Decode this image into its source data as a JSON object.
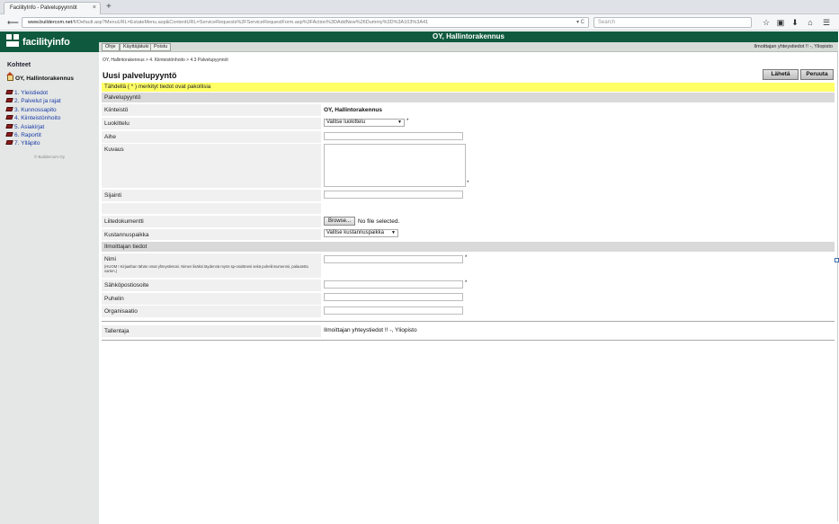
{
  "browser": {
    "tab_title": "FacilityInfo - Palvelupyynnöt",
    "tab_close": "×",
    "new_tab": "+",
    "url_host": "www.buildercom.net",
    "url_path": "/fi/Default.asp?MenuURL=EstateMenu.asp&ContentURL=ServiceRequests%2FServiceRequestForm.asp%3FAction%3DAddNew%26Dummy%3D%3A103%3A41",
    "search_placeholder": "Search",
    "back_glyph": "⟵",
    "tools": [
      "☆",
      "▣",
      "⬇",
      "⌂",
      "☰"
    ],
    "url_icons": "▾ C"
  },
  "app": {
    "logo_text": "facilityinfo",
    "header_title": "OY, Hallintorakennus",
    "menu": [
      "Ohje",
      "Käyttäjätuki",
      "Poistu"
    ],
    "user_info": "Ilmoittajan yhteystiedot !! -, Yliopisto"
  },
  "sidebar": {
    "title": "Kohteet",
    "property": "OY, Hallintorakennus",
    "items": [
      {
        "label": "1. Yleistiedot"
      },
      {
        "label": "2. Palvelut ja rajat"
      },
      {
        "label": "3. Kunnossapito"
      },
      {
        "label": "4. Kiinteistönhoito"
      },
      {
        "label": "5. Asiakirjat"
      },
      {
        "label": "6. Raportit"
      },
      {
        "label": "7. Ylläpito"
      }
    ],
    "copyright": "© Buildercom Oy"
  },
  "main": {
    "breadcrumb": "OY, Hallintorakennus > 4. Kiinteistönhoito > 4.3 Palvelupyynnöt",
    "page_title": "Uusi palvelupyyntö",
    "send_button": "Lähetä",
    "cancel_button": "Peruuta",
    "notice": "Tähdellä ( * ) merkityt tiedot ovat pakollisia",
    "section_request": "Palvelupyyntö",
    "section_reporter": "Ilmoittajan tiedot",
    "required_mark": "*",
    "fields": {
      "property_label": "Kiinteistö",
      "property_value": "OY, Hallintorakennus",
      "class_label": "Luokittelu",
      "class_value": "Valitse luokittelu",
      "subject_label": "Aihe",
      "desc_label": "Kuvaus",
      "location_label": "Sijainti",
      "attachment_label": "Liitedokumentti",
      "browse_button": "Browse...",
      "no_file": "No file selected.",
      "costcenter_label": "Kustannuspaikka",
      "costcenter_value": "Valitse kustannuspaikka",
      "name_label": "Nimi",
      "name_note": "(HUOM ! Kirjaathan tähän omat yhteystietosi. Nimen lisäksi täydennä myös sp-osoitteesi sekä puhelinnumerosi, palautetta varten.)",
      "email_label": "Sähköpostiosoite",
      "phone_label": "Puhelin",
      "org_label": "Organisaatio",
      "saver_label": "Tallentaja",
      "saver_value": "Ilmoittajan yhteystiedot !! -, Yliopisto"
    }
  }
}
